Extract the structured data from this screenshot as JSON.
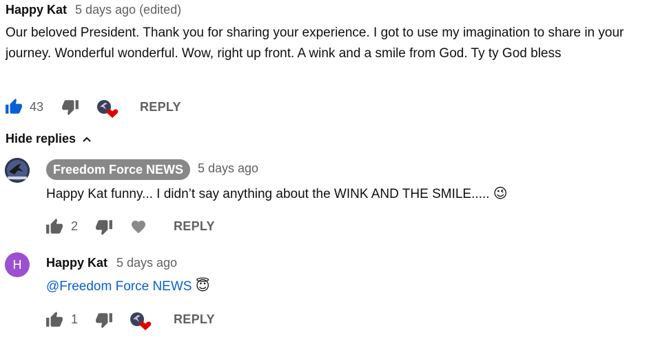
{
  "colors": {
    "like_active": "#065fd4",
    "muted": "#606060",
    "chip_bg": "#888888",
    "avatar_h": "#9c4fd1",
    "heart": "#e00000",
    "link": "#065fd4"
  },
  "top_comment": {
    "author": "Happy Kat",
    "time": "5 days ago (edited)",
    "text": "Our beloved President. Thank you for sharing your experience. I got to use my imagination to share in your journey.  Wonderful wonderful. Wow,  right up front. A wink and a smile from God.  Ty ty God bless",
    "likes": "43",
    "like_icon": "thumbs-up-filled",
    "dislike_icon": "thumbs-down",
    "hearted": true,
    "reply_label": "REPLY"
  },
  "hide_replies_label": "Hide replies",
  "replies": [
    {
      "author": "Freedom Force NEWS",
      "author_is_channel_owner": true,
      "time": "5 days ago",
      "text": "Happy Kat funny... I didn’t say anything about the WINK AND THE SMILE.....",
      "emoji": "😉",
      "likes": "2",
      "reply_label": "REPLY"
    },
    {
      "author": "Happy Kat",
      "avatar_letter": "H",
      "time": "5 days ago",
      "mention": "@Freedom Force NEWS",
      "emoji": "😇",
      "likes": "1",
      "hearted": true,
      "reply_label": "REPLY"
    }
  ]
}
